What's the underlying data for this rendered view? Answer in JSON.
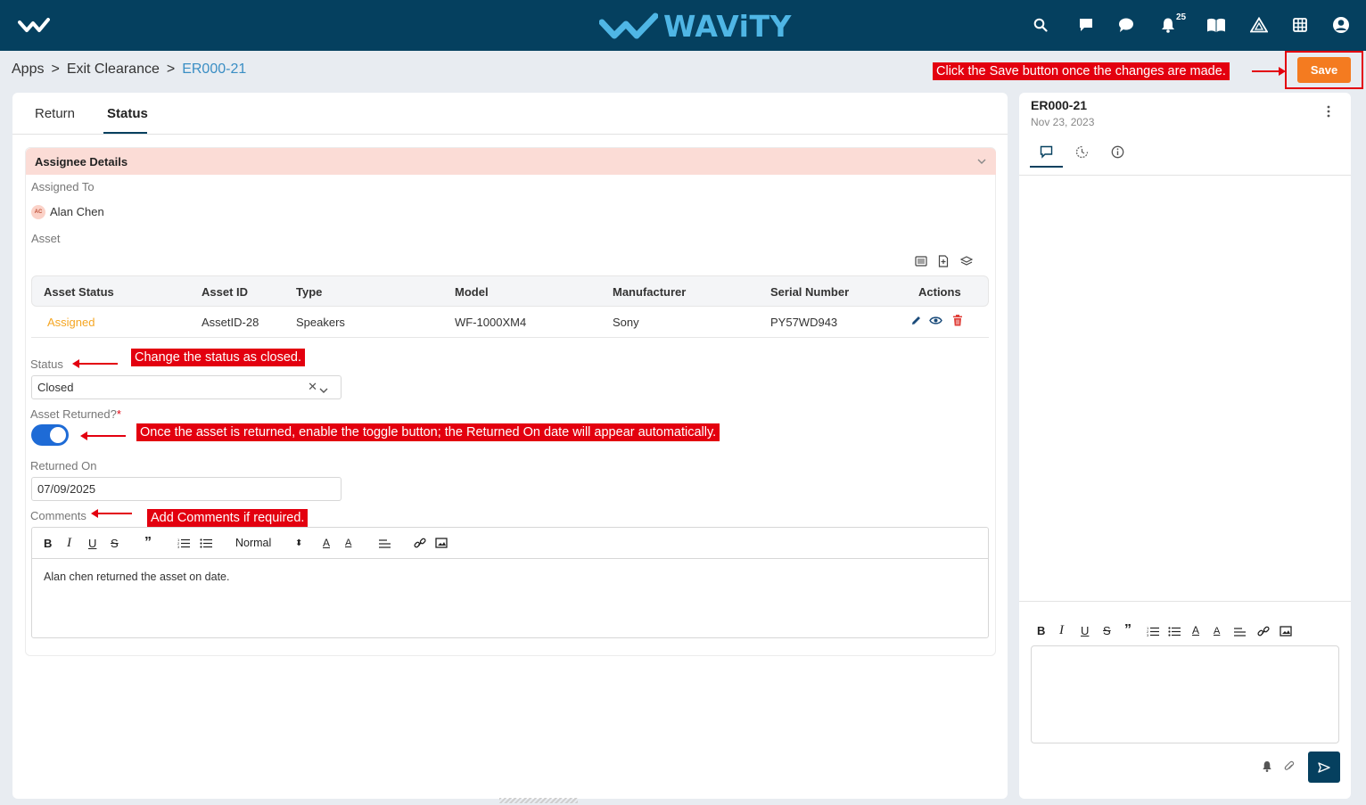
{
  "brand": {
    "name": "WAViTY"
  },
  "topbar": {
    "notification_count": "25"
  },
  "breadcrumb": {
    "items": [
      "Apps",
      "Exit Clearance",
      "ER000-21"
    ],
    "separator": ">"
  },
  "actions": {
    "save_label": "Save"
  },
  "callouts": {
    "save": "Click the Save button once the changes are made.",
    "status": "Change the status as closed.",
    "toggle": "Once the asset is returned, enable the toggle button; the Returned On date will appear automatically.",
    "comments": "Add Comments if required."
  },
  "tabs": [
    {
      "label": "Return"
    },
    {
      "label": "Status",
      "active": true
    }
  ],
  "assignee": {
    "section_title": "Assignee Details",
    "assigned_to_label": "Assigned To",
    "assignee_initials": "AC",
    "assignee_name": "Alan Chen",
    "asset_label": "Asset"
  },
  "asset_table": {
    "columns": [
      "Asset Status",
      "Asset ID",
      "Type",
      "Model",
      "Manufacturer",
      "Serial Number",
      "Actions"
    ],
    "rows": [
      {
        "status": "Assigned",
        "asset_id": "AssetID-28",
        "type": "Speakers",
        "model": "WF-1000XM4",
        "manufacturer": "Sony",
        "serial": "PY57WD943"
      }
    ]
  },
  "form": {
    "status_label": "Status",
    "status_value": "Closed",
    "asset_returned_label": "Asset Returned?",
    "required_mark": "*",
    "asset_returned": true,
    "returned_on_label": "Returned On",
    "returned_on_value": "07/09/2025",
    "comments_label": "Comments",
    "comment_text": "Alan chen returned the asset on date.",
    "text_style": "Normal"
  },
  "side_panel": {
    "title": "ER000-21",
    "date": "Nov 23, 2023"
  },
  "colors": {
    "navy": "#05405f",
    "accent_orange": "#f47b20",
    "callout_red": "#e3000f",
    "assigned_status": "#f5a623",
    "toggle_on": "#1e6bd6"
  }
}
